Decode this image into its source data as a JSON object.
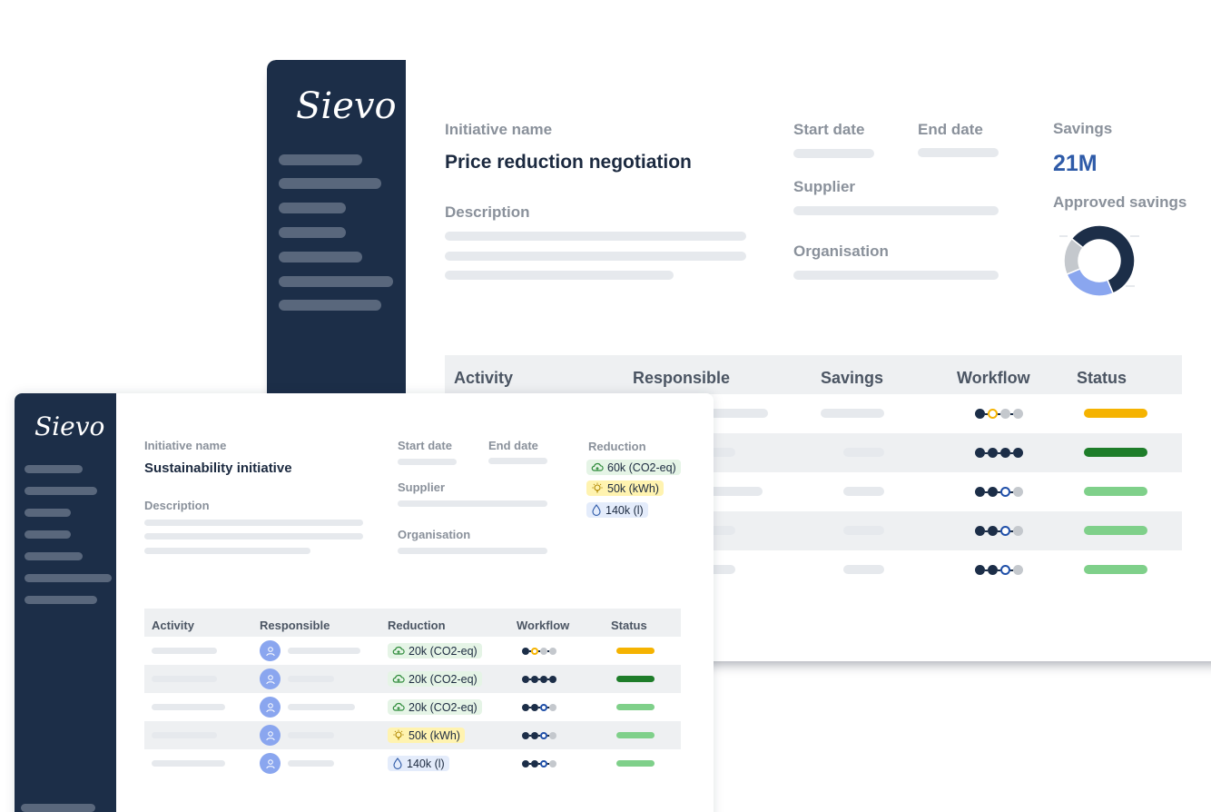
{
  "back_window": {
    "logo": "Sievo",
    "initiative_name_label": "Initiative name",
    "initiative_name": "Price reduction negotiation",
    "description_label": "Description",
    "start_date_label": "Start date",
    "end_date_label": "End date",
    "supplier_label": "Supplier",
    "organisation_label": "Organisation",
    "savings_label": "Savings",
    "savings_value": "21M",
    "approved_savings_label": "Approved savings",
    "approved_savings_chart": {
      "type": "pie",
      "segments": [
        {
          "share": 0.58,
          "color": "#1c2e48"
        },
        {
          "share": 0.25,
          "color": "#8aa6ef"
        },
        {
          "share": 0.17,
          "color": "#c4c8cd"
        }
      ]
    },
    "table": {
      "headers": [
        "Activity",
        "Responsible",
        "Savings",
        "Workflow",
        "Status"
      ],
      "rows": [
        {
          "workflow": [
            "done",
            "current-warning",
            "pending",
            "pending"
          ],
          "status_color": "#f5b301"
        },
        {
          "workflow": [
            "done",
            "done",
            "done",
            "done"
          ],
          "status_color": "#1e7d2a"
        },
        {
          "workflow": [
            "done",
            "done",
            "current",
            "pending"
          ],
          "status_color": "#7fd08a"
        },
        {
          "workflow": [
            "done",
            "done",
            "current",
            "pending"
          ],
          "status_color": "#7fd08a"
        },
        {
          "workflow": [
            "done",
            "done",
            "current",
            "pending"
          ],
          "status_color": "#7fd08a"
        }
      ]
    }
  },
  "front_window": {
    "logo": "Sievo",
    "initiative_name_label": "Initiative name",
    "initiative_name": "Sustainability initiative",
    "description_label": "Description",
    "start_date_label": "Start date",
    "end_date_label": "End date",
    "supplier_label": "Supplier",
    "organisation_label": "Organisation",
    "reduction_label": "Reduction",
    "reductions": [
      {
        "icon": "cloud-icon",
        "text": "60k (CO2-eq)"
      },
      {
        "icon": "lightbulb-icon",
        "text": "50k (kWh)"
      },
      {
        "icon": "water-drop-icon",
        "text": "140k (l)"
      }
    ],
    "table": {
      "headers": [
        "Activity",
        "Responsible",
        "Reduction",
        "Workflow",
        "Status"
      ],
      "rows": [
        {
          "reduction": "20k (CO2-eq)",
          "reduction_icon": "cloud-icon",
          "workflow": [
            "done",
            "current-warning",
            "pending",
            "pending"
          ],
          "status_color": "#f5b301"
        },
        {
          "reduction": "20k (CO2-eq)",
          "reduction_icon": "cloud-icon",
          "workflow": [
            "done",
            "done",
            "done",
            "done"
          ],
          "status_color": "#1e7d2a"
        },
        {
          "reduction": "20k (CO2-eq)",
          "reduction_icon": "cloud-icon",
          "workflow": [
            "done",
            "done",
            "current",
            "pending"
          ],
          "status_color": "#7fd08a"
        },
        {
          "reduction": "50k (kWh)",
          "reduction_icon": "lightbulb-icon",
          "workflow": [
            "done",
            "done",
            "current",
            "pending"
          ],
          "status_color": "#7fd08a"
        },
        {
          "reduction": "140k (l)",
          "reduction_icon": "water-drop-icon",
          "workflow": [
            "done",
            "done",
            "current",
            "pending"
          ],
          "status_color": "#7fd08a"
        }
      ]
    }
  }
}
